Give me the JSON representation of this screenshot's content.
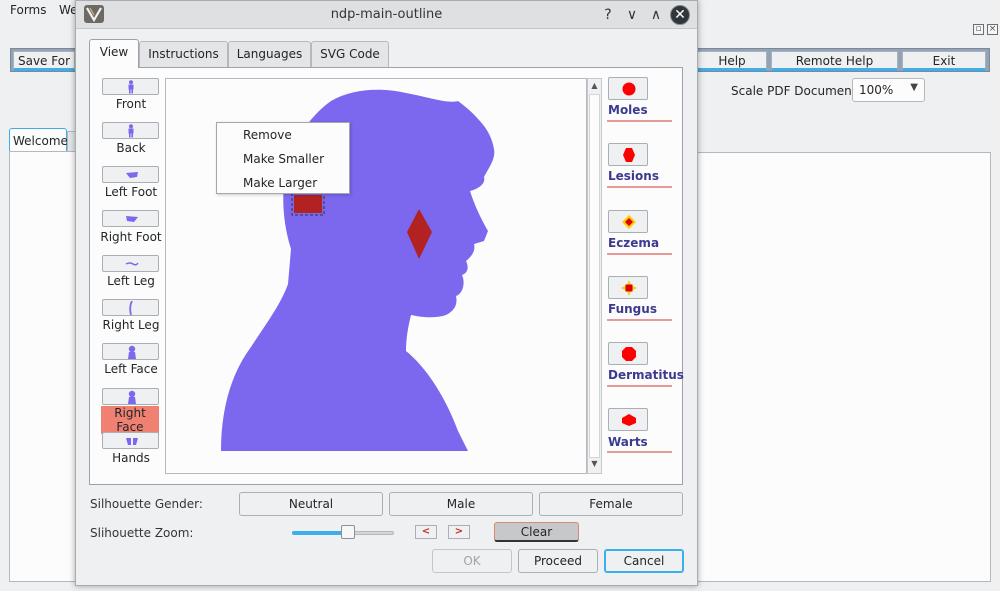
{
  "bg_app": {
    "menu": [
      "Forms",
      "We"
    ],
    "toolbar": {
      "save_label": "Save For",
      "help_label": "Help",
      "remote_help_label": "Remote Help",
      "exit_label": "Exit"
    },
    "scale_label": "Scale PDF Document:",
    "scale_value": "100%",
    "welcome_tab": "Welcome"
  },
  "dialog": {
    "title": "ndp-main-outline",
    "title_controls": {
      "help": "?",
      "minimize": "∨",
      "maximize": "∧",
      "close": "✕"
    },
    "tabs": [
      "View",
      "Instructions",
      "Languages",
      "SVG Code"
    ],
    "active_tab": "View",
    "body_parts": [
      {
        "label": "Front",
        "icon": "front-body-icon",
        "selected": false
      },
      {
        "label": "Back",
        "icon": "back-body-icon",
        "selected": false
      },
      {
        "label": "Left Foot",
        "icon": "left-foot-icon",
        "selected": false
      },
      {
        "label": "Right Foot",
        "icon": "right-foot-icon",
        "selected": false
      },
      {
        "label": "Left Leg",
        "icon": "left-leg-icon",
        "selected": false
      },
      {
        "label": "Right Leg",
        "icon": "right-leg-icon",
        "selected": false
      },
      {
        "label": "Left Face",
        "icon": "left-face-icon",
        "selected": false
      },
      {
        "label": "Right Face",
        "icon": "right-face-icon",
        "selected": true
      },
      {
        "label": "Hands",
        "icon": "hands-icon",
        "selected": false
      }
    ],
    "context_menu": [
      "Remove",
      "Make Smaller",
      "Make Larger"
    ],
    "legend": [
      {
        "label": "Moles",
        "icon": "red-circle-icon"
      },
      {
        "label": "Lesions",
        "icon": "red-hexagon-icon"
      },
      {
        "label": "Eczema",
        "icon": "diamond-icon"
      },
      {
        "label": "Fungus",
        "icon": "star-square-icon"
      },
      {
        "label": "Dermatitus",
        "icon": "red-octagon-icon"
      },
      {
        "label": "Warts",
        "icon": "red-flat-hexagon-icon"
      }
    ],
    "gender_label": "Silhouette Gender:",
    "gender_options": [
      "Neutral",
      "Male",
      "Female"
    ],
    "zoom_label": "Slihouette Zoom:",
    "zoom_level": 0.55,
    "zoom_prev": "<",
    "zoom_next": ">",
    "clear_label": "Clear",
    "ok_label": "OK",
    "proceed_label": "Proceed",
    "cancel_label": "Cancel"
  },
  "colors": {
    "silhouette": "#7b68ee",
    "marker": "#b22222",
    "selected_part": "#f08072",
    "legend_text": "#3c3a8f",
    "accent": "#3daee9"
  }
}
